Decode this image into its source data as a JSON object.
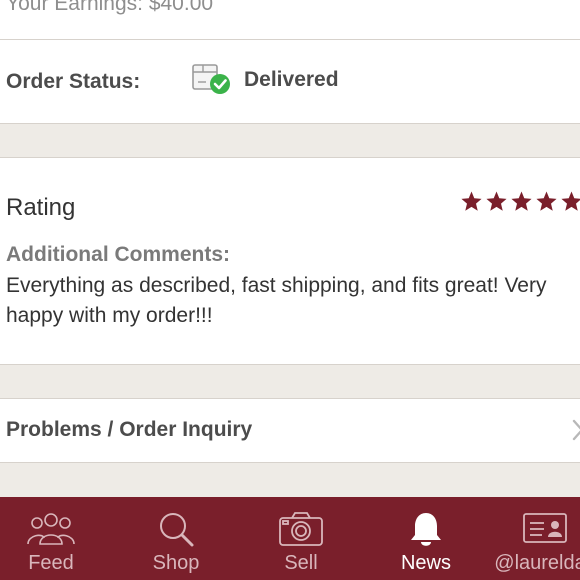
{
  "order": {
    "earnings": "Your Earnings: $40.00",
    "status_label": "Order Status:",
    "status_value": "Delivered",
    "status_icon": "delivered-box-check-icon"
  },
  "rating": {
    "title": "Rating",
    "stars": 5,
    "star_color": "#7a1f2b",
    "comments_title": "Additional Comments:",
    "comments_lines": [
      "Everything as described, fast shipping, and fits great! Very",
      "happy with my order!!!"
    ]
  },
  "problems": {
    "label": "Problems / Order Inquiry"
  },
  "tabbar": {
    "tabs": [
      {
        "label": "Feed",
        "icon": "people-icon"
      },
      {
        "label": "Shop",
        "icon": "search-icon"
      },
      {
        "label": "Sell",
        "icon": "camera-icon"
      },
      {
        "label": "News",
        "icon": "bell-icon"
      },
      {
        "label": "@laurelday",
        "icon": "profile-card-icon"
      }
    ],
    "active": "News",
    "background": "#7a1f2b"
  },
  "colors": {
    "page_background": "#eeebe6",
    "card": "#ffffff",
    "check_green": "#3bb34a"
  }
}
